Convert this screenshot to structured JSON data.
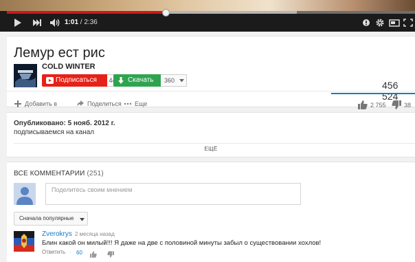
{
  "player": {
    "time_current": "1:01",
    "time_separator": " / ",
    "time_total": "2:36",
    "played_fraction": 0.39,
    "buffered_fraction": 0.71,
    "controls": [
      "play-icon",
      "next-icon",
      "volume-icon",
      "annotations-icon",
      "settings-icon",
      "miniplayer-icon",
      "fullscreen-icon"
    ]
  },
  "video": {
    "title": "Лемур ест рис",
    "channel_name": "COLD WINTER",
    "subscribe_label": "Подписаться",
    "subscriber_count": "441",
    "download_label": "Скачать",
    "download_quality": "360",
    "views": "456 524",
    "likes": "2 755",
    "dislikes": "38"
  },
  "actions": {
    "add_to": "Добавить в",
    "share": "Поделиться",
    "more": "Еще"
  },
  "description": {
    "published": "Опубликовано: 5 нояб. 2012 г.",
    "text": "подписываемся на канал",
    "show_more": "ЕЩЁ"
  },
  "comments": {
    "heading": "ВСЕ КОММЕНТАРИИ",
    "count": "(251)",
    "input_placeholder": "Поделитесь своим мнением",
    "sort_label": "Сначала популярные",
    "items": [
      {
        "author": "Zverokrys",
        "time": "2 месяца назад",
        "text": "Блин какой он милый!!! Я даже на две с половиной минуты забыл о существовании хохлов!",
        "reply": "Ответить",
        "separator": "·",
        "likes": "60"
      }
    ]
  },
  "colors": {
    "accent_red": "#cc181e",
    "subscribe_red": "#e62117",
    "download_green": "#2fa44f",
    "link_blue": "#167ac6"
  }
}
